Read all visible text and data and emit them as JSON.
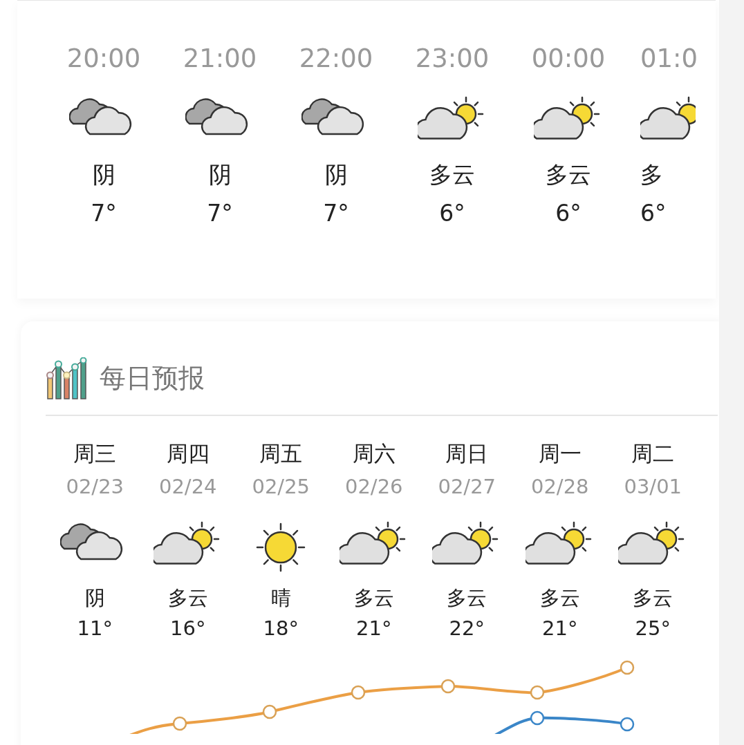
{
  "hourly": [
    {
      "time": "20:00",
      "kind": "overcast",
      "condition": "阴",
      "temp": "7°"
    },
    {
      "time": "21:00",
      "kind": "overcast",
      "condition": "阴",
      "temp": "7°"
    },
    {
      "time": "22:00",
      "kind": "overcast",
      "condition": "阴",
      "temp": "7°"
    },
    {
      "time": "23:00",
      "kind": "partly-cloudy",
      "condition": "多云",
      "temp": "6°"
    },
    {
      "time": "00:00",
      "kind": "partly-cloudy",
      "condition": "多云",
      "temp": "6°"
    },
    {
      "time": "01:0",
      "kind": "partly-cloudy",
      "condition": "多",
      "temp": "6°"
    }
  ],
  "daily": {
    "title": "每日预报",
    "days": [
      {
        "day": "周三",
        "date": "02/23",
        "kind": "overcast",
        "condition": "阴",
        "temp": "11°"
      },
      {
        "day": "周四",
        "date": "02/24",
        "kind": "partly-cloudy",
        "condition": "多云",
        "temp": "16°"
      },
      {
        "day": "周五",
        "date": "02/25",
        "kind": "sunny",
        "condition": "晴",
        "temp": "18°"
      },
      {
        "day": "周六",
        "date": "02/26",
        "kind": "partly-cloudy",
        "condition": "多云",
        "temp": "21°"
      },
      {
        "day": "周日",
        "date": "02/27",
        "kind": "partly-cloudy",
        "condition": "多云",
        "temp": "22°"
      },
      {
        "day": "周一",
        "date": "02/28",
        "kind": "partly-cloudy",
        "condition": "多云",
        "temp": "21°"
      },
      {
        "day": "周二",
        "date": "03/01",
        "kind": "partly-cloudy",
        "condition": "多云",
        "temp": "25°"
      }
    ]
  }
}
